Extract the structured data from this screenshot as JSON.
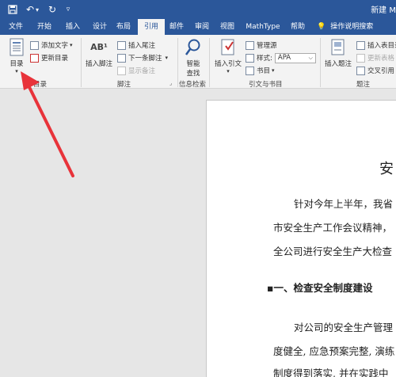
{
  "titlebar": {
    "doc_title": "新建 M"
  },
  "tabs": [
    {
      "label": "文件"
    },
    {
      "label": "开始"
    },
    {
      "label": "插入"
    },
    {
      "label": "设计"
    },
    {
      "label": "布局"
    },
    {
      "label": "引用",
      "active": true
    },
    {
      "label": "邮件"
    },
    {
      "label": "审阅"
    },
    {
      "label": "视图"
    },
    {
      "label": "MathType"
    },
    {
      "label": "帮助"
    }
  ],
  "help_search": "操作说明搜索",
  "ribbon": {
    "toc": {
      "big_label": "目录",
      "add_text": "添加文字",
      "update_toc": "更新目录",
      "group_label": "目录"
    },
    "footnotes": {
      "insert_footnote": "插入脚注",
      "footnote_glyph": "AB¹",
      "insert_endnote": "插入尾注",
      "next_footnote": "下一条脚注",
      "show_notes": "显示备注",
      "group_label": "脚注"
    },
    "research": {
      "smart_lookup": "智能\n查找",
      "smart_lookup_line1": "智能",
      "smart_lookup_line2": "查找",
      "group_label": "信息检索"
    },
    "citations": {
      "insert_citation": "插入引文",
      "manage_sources": "管理源",
      "style_label": "样式:",
      "style_value": "APA",
      "bibliography": "书目",
      "group_label": "引文与书目"
    },
    "captions": {
      "insert_caption": "插入题注",
      "insert_table_of_figures": "插入表目录",
      "update_table": "更新表格",
      "cross_reference": "交叉引用",
      "group_label": "题注"
    }
  },
  "document": {
    "title_fragment": "安",
    "para1_line1": "针对今年上半年，我省",
    "para1_line2": "市安全生产工作会议精神，",
    "para1_line3": "全公司进行安全生产大检查",
    "heading1": "一、检查安全制度建设",
    "para2_line1": "对公司的安全生产管理",
    "para2_line2": "度健全, 应急预案完整, 演练",
    "para2_line3": "制度得到落实, 并在实践中"
  },
  "colors": {
    "title_bar": "#2b579a",
    "ribbon_bg": "#f3f3f3",
    "arrow": "#e8333a"
  }
}
